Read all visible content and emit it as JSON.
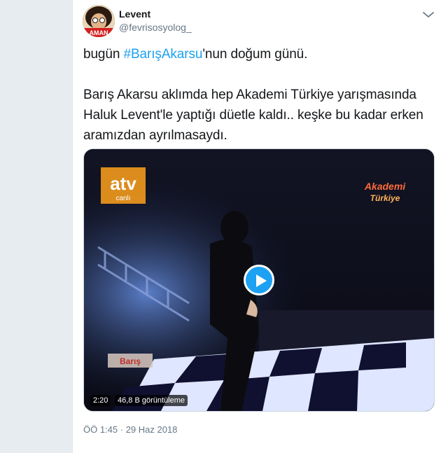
{
  "author": {
    "name": "Levent",
    "handle": "@fevrisosyolog_"
  },
  "tweet": {
    "prefix": "bugün ",
    "hashtag": "#BarışAkarsu",
    "suffix": "'nun doğum günü.",
    "body": "Barış Akarsu aklımda hep Akademi Türkiye yarışmasında Haluk Levent'le yaptığı düetle kaldı.. keşke bu kadar erken aramızdan ayrılmasaydı."
  },
  "media": {
    "duration": "2:20",
    "views": "46,8 B görüntüleme",
    "channel_logo": "atv",
    "channel_sub": "canlı",
    "show_logo_line1": "Akademi",
    "show_logo_line2": "Türkiye",
    "name_caption": "Barış"
  },
  "timestamp": "ÖÖ 1:45 · 29 Haz 2018",
  "icons": {
    "menu": "chevron-down-icon",
    "play": "play-icon"
  },
  "colors": {
    "link": "#1da1f2",
    "text": "#14171a",
    "secondary": "#657786",
    "background": "#e6ecf0"
  }
}
